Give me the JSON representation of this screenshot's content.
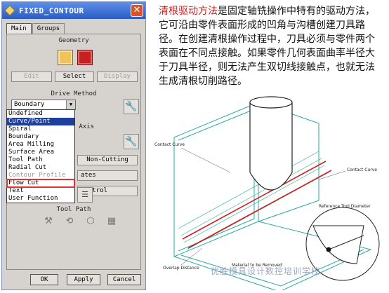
{
  "dialog": {
    "title": "FIXED_CONTOUR",
    "close_symbol": "✕",
    "tabs": [
      "Main",
      "Groups"
    ],
    "geometry_label": "Geometry",
    "geometry_buttons": {
      "edit": "Edit",
      "select": "Select",
      "display": "Display"
    },
    "drive_method_label": "Drive Method",
    "drive_method_value": "Boundary",
    "dropdown_items": [
      "Undefined",
      "Curve/Point",
      "Spiral",
      "Boundary",
      "Area Milling",
      "Surface Area",
      "Tool Path",
      "Radial Cut",
      "Contour Profile",
      "Flow Cut",
      "Text",
      "User Function"
    ],
    "dropdown_selected": "Curve/Point",
    "dropdown_disabled": "Contour Profile",
    "dropdown_highlighted": "Flow Cut",
    "partial_labels": {
      "axis": "Axis",
      "non_cutting": "Non-Cutting",
      "feeds": "ates",
      "control": "Control",
      "tool_path": "Tool Path"
    },
    "footer": {
      "ok": "OK",
      "apply": "Apply",
      "cancel": "Cancel"
    }
  },
  "description": {
    "highlight": "清根驱动方法",
    "text": "是固定轴铣操作中特有的驱动方法，它可沿由零件表面形成的凹角与沟槽创建刀具路径。在创建清根操作过程中，刀具必须与零件两个表面在不同点接触。如果零件几何表面曲率半径大于刀具半径，则无法产生双切线接触点，也就无法生成清根切削路径。"
  },
  "diagram_labels": {
    "contact_curve_left": "Contact Curve",
    "contact_curve_right": "Contact Curve",
    "reference_tool": "Reference Tool Diameter",
    "overlap": "Overlap Distance",
    "material": "Material to be Removed"
  },
  "watermark": "优胜模具设计数控培训学校",
  "colors": {
    "accent": "#d02020",
    "title_bar": "#2a5cc4",
    "selection": "#1f3fa0"
  }
}
